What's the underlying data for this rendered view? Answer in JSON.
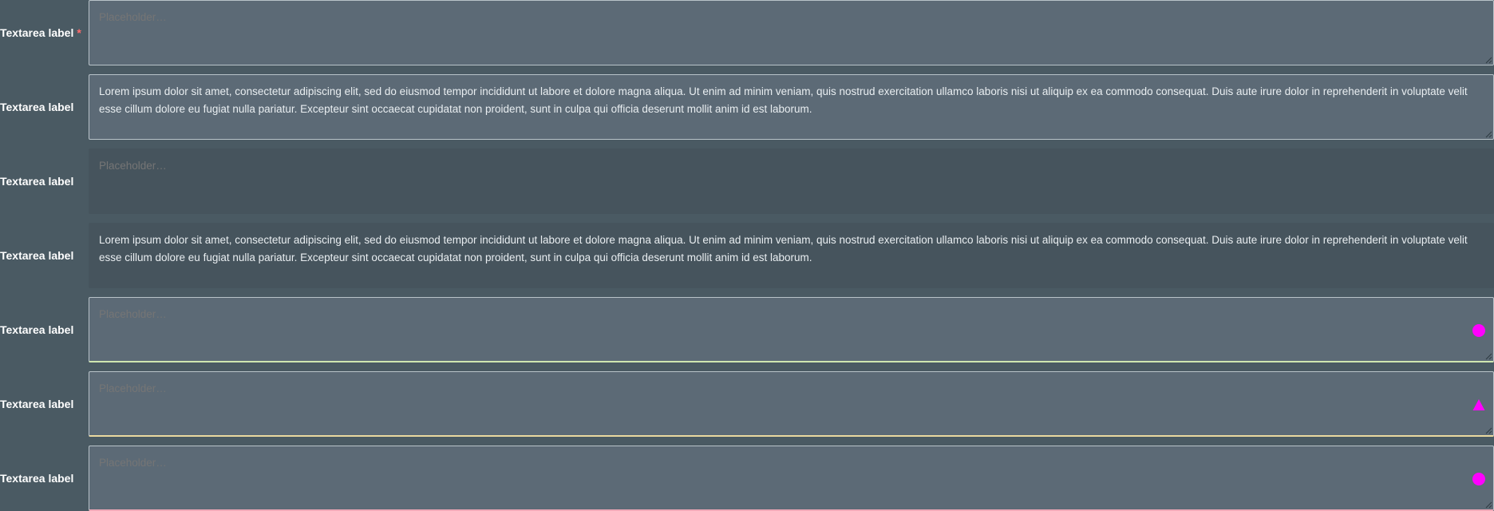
{
  "fields": [
    {
      "label": "Textarea label",
      "required_mark": "*",
      "placeholder": "Placeholder…",
      "value": ""
    },
    {
      "label": "Textarea label",
      "value": "Lorem ipsum dolor sit amet, consectetur adipiscing elit, sed do eiusmod tempor incididunt ut labore et dolore magna aliqua. Ut enim ad minim veniam, quis nostrud exercitation ullamco laboris nisi ut aliquip ex ea commodo consequat. Duis aute irure dolor in reprehenderit in voluptate velit esse cillum dolore eu fugiat nulla pariatur. Excepteur sint occaecat cupidatat non proident, sunt in culpa qui officia deserunt mollit anim id est laborum."
    },
    {
      "label": "Textarea label",
      "placeholder": "Placeholder…",
      "value": "",
      "state": "disabled"
    },
    {
      "label": "Textarea label",
      "value": "Lorem ipsum dolor sit amet, consectetur adipiscing elit, sed do eiusmod tempor incididunt ut labore et dolore magna aliqua. Ut enim ad minim veniam, quis nostrud exercitation ullamco laboris nisi ut aliquip ex ea commodo consequat. Duis aute irure dolor in reprehenderit in voluptate velit esse cillum dolore eu fugiat nulla pariatur. Excepteur sint occaecat cupidatat non proident, sunt in culpa qui officia deserunt mollit anim id est laborum.",
      "state": "disabled"
    },
    {
      "label": "Textarea label",
      "placeholder": "Placeholder…",
      "value": "",
      "state": "success",
      "icon": "circle-status-icon"
    },
    {
      "label": "Textarea label",
      "placeholder": "Placeholder…",
      "value": "",
      "state": "warning",
      "icon": "warning-triangle-icon"
    },
    {
      "label": "Textarea label",
      "placeholder": "Placeholder…",
      "value": "",
      "state": "error",
      "icon": "circle-status-icon"
    }
  ],
  "colors": {
    "background": "#4a5a63",
    "field": "#5c6a76",
    "field_disabled": "#46545d",
    "border": "#b9c3c9",
    "success": "#cfe6b0",
    "warning": "#ead9a0",
    "error": "#f0a9b8",
    "status_icon": "#ff00ff",
    "required": "#ff6b6b"
  }
}
